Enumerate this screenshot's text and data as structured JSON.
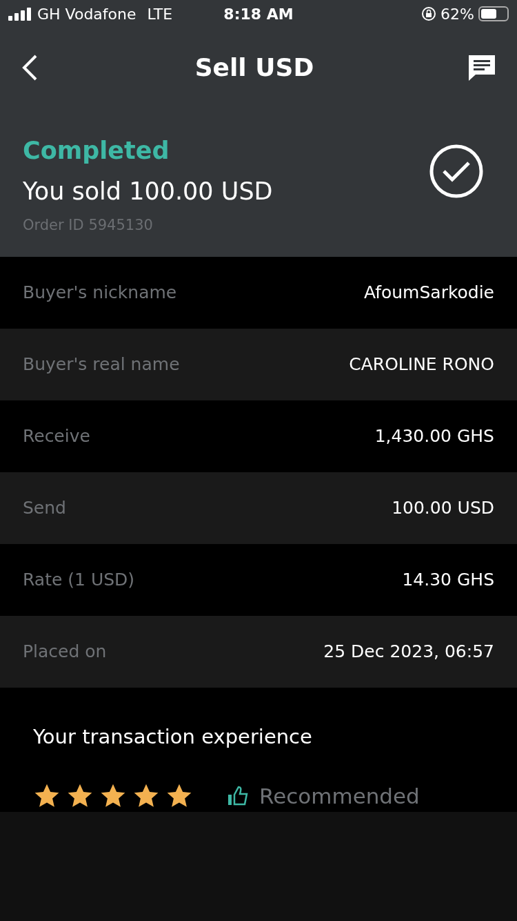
{
  "status_bar": {
    "carrier": "GH Vodafone",
    "network": "LTE",
    "time": "8:18 AM",
    "battery": "62%"
  },
  "nav": {
    "title": "Sell USD"
  },
  "order": {
    "status": "Completed",
    "summary": "You sold 100.00 USD",
    "order_id": "Order ID 5945130",
    "completed": true
  },
  "details": [
    {
      "label": "Buyer's nickname",
      "value": "AfoumSarkodie"
    },
    {
      "label": "Buyer's real name",
      "value": "CAROLINE RONO"
    },
    {
      "label": "Receive",
      "value": "1,430.00 GHS"
    },
    {
      "label": "Send",
      "value": "100.00 USD"
    },
    {
      "label": "Rate (1 USD)",
      "value": "14.30 GHS"
    },
    {
      "label": "Placed on",
      "value": "25 Dec 2023, 06:57"
    }
  ],
  "feedback": {
    "title": "Your transaction experience",
    "stars": 5,
    "recommendation": "Recommended",
    "recommended": true
  }
}
